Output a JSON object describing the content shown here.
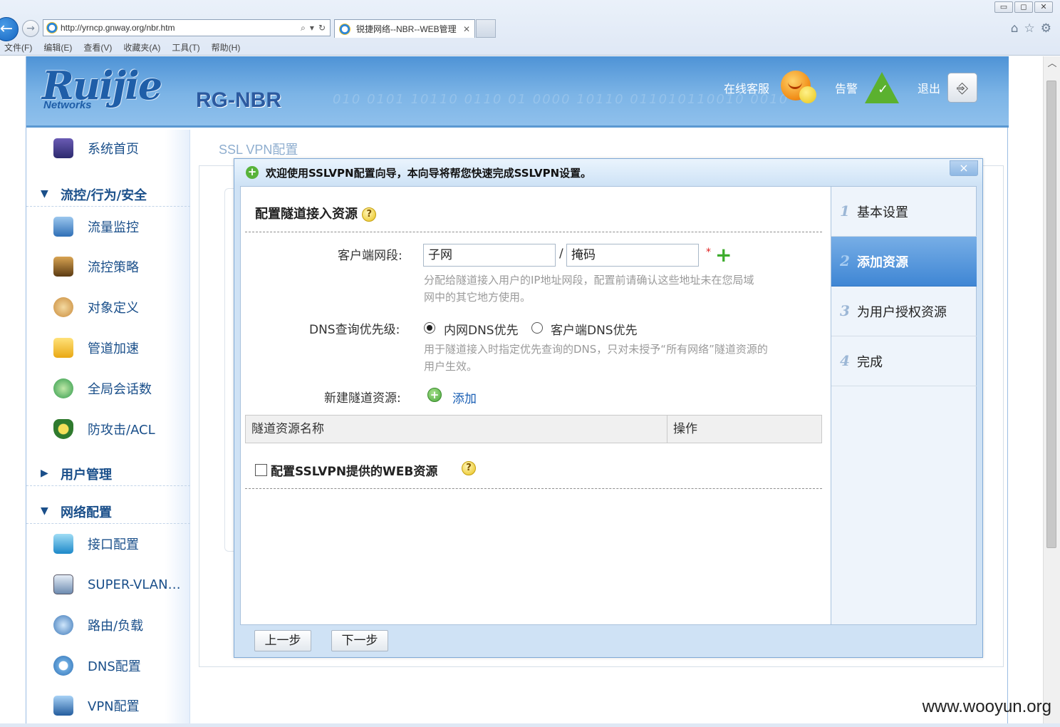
{
  "browser": {
    "address": "http://yrncp.gnway.org/nbr.htm",
    "tab_title": "锐捷网络--NBR--WEB管理",
    "menu": [
      "文件(F)",
      "编辑(E)",
      "查看(V)",
      "收藏夹(A)",
      "工具(T)",
      "帮助(H)"
    ]
  },
  "header": {
    "logo_text": "Ruijie",
    "logo_sub": "Networks",
    "product": "RG-NBR",
    "online_service": "在线客服",
    "alarm": "告警",
    "logout": "退出"
  },
  "sidebar": {
    "home": "系统首页",
    "group1": "流控/行为/安全",
    "group1_items": [
      "流量监控",
      "流控策略",
      "对象定义",
      "管道加速",
      "全局会话数",
      "防攻击/ACL"
    ],
    "group2": "用户管理",
    "group3": "网络配置",
    "group3_items": [
      "接口配置",
      "SUPER-VLAN…",
      "路由/负载",
      "DNS配置",
      "VPN配置"
    ]
  },
  "content": {
    "title": "SSL VPN配置"
  },
  "wizard": {
    "title": "欢迎使用SSLVPN配置向导，本向导将帮您快速完成SSLVPN设置。",
    "close": "×",
    "section_title": "配置隧道接入资源",
    "client_segment_label": "客户端网段:",
    "subnet_placeholder": "子网",
    "slash": "/",
    "mask_placeholder": "掩码",
    "required_mark": "*",
    "client_hint_line1": "分配给隧道接入用户的IP地址网段，配置前请确认这些地址未在您局域",
    "client_hint_line2": "网中的其它地方使用。",
    "dns_label": "DNS查询优先级:",
    "dns_option1": "内网DNS优先",
    "dns_option2": "客户端DNS优先",
    "dns_selected": "内网DNS优先",
    "dns_hint_line1": "用于隧道接入时指定优先查询的DNS，只对未授予“所有网络”隧道资源的",
    "dns_hint_line2": "用户生效。",
    "new_resource_label": "新建隧道资源:",
    "add_link": "添加",
    "table_headers": [
      "隧道资源名称",
      "操作"
    ],
    "web_resource_label": "配置SSLVPN提供的WEB资源",
    "web_resource_checked": false,
    "prev_button": "上一步",
    "next_button": "下一步",
    "steps": [
      {
        "num": "1",
        "label": "基本设置"
      },
      {
        "num": "2",
        "label": "添加资源"
      },
      {
        "num": "3",
        "label": "为用户授权资源"
      },
      {
        "num": "4",
        "label": "完成"
      }
    ],
    "active_step": 2
  },
  "watermark": "www.wooyun.org",
  "colors": {
    "banner": "#4e93d6",
    "active_step": "#3f86d4",
    "link": "#1a5fb4",
    "hint": "#9a9a9a"
  }
}
